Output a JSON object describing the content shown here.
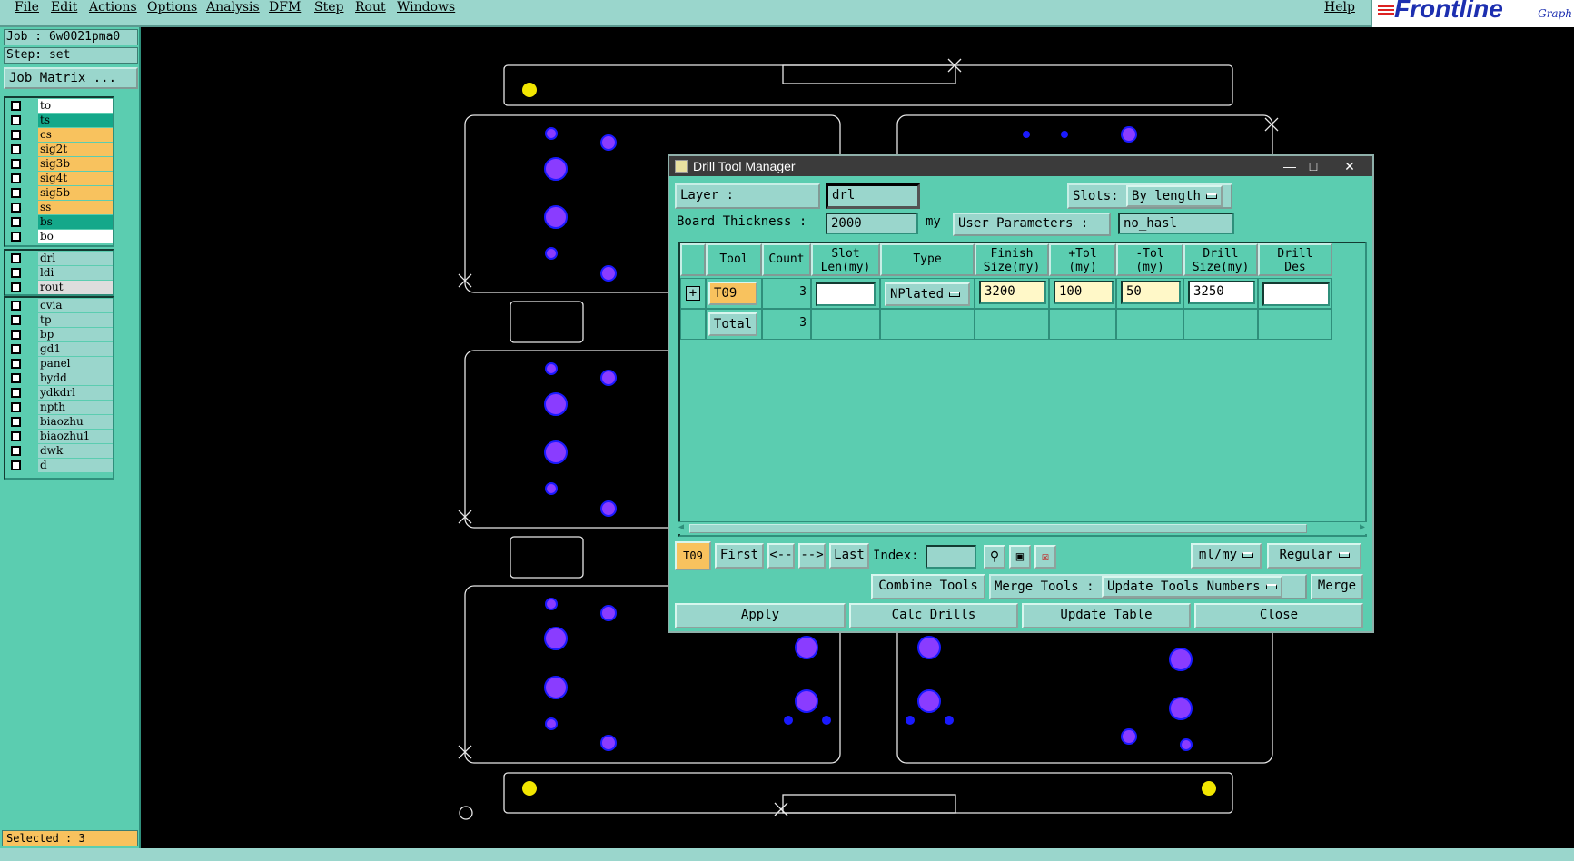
{
  "menu": {
    "items": [
      "File",
      "Edit",
      "Actions",
      "Options",
      "Analysis",
      "DFM",
      "Step",
      "Rout",
      "Windows"
    ],
    "help": "Help"
  },
  "logo": {
    "brand": "Frontline",
    "sub": "Graph"
  },
  "left": {
    "job": "Job : 6w0021pma0",
    "step": "Step: set",
    "job_matrix": "Job Matrix ...",
    "group1": [
      {
        "name": "to",
        "color": "#ffffff"
      },
      {
        "name": "ts",
        "color": "#14a88a"
      },
      {
        "name": "cs",
        "color": "#f8c25e"
      },
      {
        "name": "sig2t",
        "color": "#f8c25e"
      },
      {
        "name": "sig3b",
        "color": "#f8c25e"
      },
      {
        "name": "sig4t",
        "color": "#f8c25e"
      },
      {
        "name": "sig5b",
        "color": "#f8c25e"
      },
      {
        "name": "ss",
        "color": "#f8c25e"
      },
      {
        "name": "bs",
        "color": "#14a88a"
      },
      {
        "name": "bo",
        "color": "#ffffff"
      }
    ],
    "group2": [
      {
        "name": "drl",
        "color": "#9ad6cc"
      },
      {
        "name": "ldi",
        "color": "#9ad6cc"
      },
      {
        "name": "rout",
        "color": "#dddddd"
      }
    ],
    "group3": [
      {
        "name": "cvia",
        "color": "#9ad6cc"
      },
      {
        "name": "tp",
        "color": "#9ad6cc"
      },
      {
        "name": "bp",
        "color": "#9ad6cc"
      },
      {
        "name": "gd1",
        "color": "#9ad6cc"
      },
      {
        "name": "panel",
        "color": "#9ad6cc"
      },
      {
        "name": "bydd",
        "color": "#9ad6cc"
      },
      {
        "name": "ydkdrl",
        "color": "#9ad6cc"
      },
      {
        "name": "npth",
        "color": "#9ad6cc"
      },
      {
        "name": "biaozhu",
        "color": "#9ad6cc"
      },
      {
        "name": "biaozhu1",
        "color": "#9ad6cc"
      },
      {
        "name": "dwk",
        "color": "#9ad6cc"
      },
      {
        "name": "d",
        "color": "#9ad6cc"
      }
    ],
    "selected": "Selected : 3"
  },
  "dialog": {
    "title": "Drill Tool Manager",
    "layer_label": "Layer         :",
    "layer_value": "drl",
    "slots_label": "Slots:",
    "slots_value": "By length",
    "thickness_label": "Board Thickness :",
    "thickness_value": "2000",
    "thickness_unit": "my",
    "user_params_label": "User Parameters :",
    "user_params_value": "no_hasl",
    "columns": [
      [
        "Tool",
        ""
      ],
      [
        "Count",
        ""
      ],
      [
        "Slot",
        "Len(my)"
      ],
      [
        "Type",
        ""
      ],
      [
        "Finish",
        "Size(my)"
      ],
      [
        "+Tol",
        "(my)"
      ],
      [
        "-Tol",
        "(my)"
      ],
      [
        "Drill",
        "Size(my)"
      ],
      [
        "Drill",
        "Des"
      ]
    ],
    "row": {
      "tool": "T09",
      "count": "3",
      "slot_len": "",
      "type": "NPlated",
      "finish": "3200",
      "ptol": "100",
      "mtol": "50",
      "drill": "3250",
      "des": ""
    },
    "total": {
      "label": "Total",
      "count": "3"
    },
    "nav": {
      "current": "T09",
      "first": "First",
      "prev": "<--",
      "next": "-->",
      "last": "Last",
      "index_label": "Index:",
      "index_value": "",
      "units": "ml/my",
      "mode": "Regular"
    },
    "tools": {
      "combine": "Combine Tools",
      "merge_label": "Merge Tools :",
      "merge_value": "Update Tools Numbers",
      "merge": "Merge"
    },
    "actions": {
      "apply": "Apply",
      "calc": "Calc Drills",
      "update": "Update Table",
      "close": "Close"
    }
  }
}
